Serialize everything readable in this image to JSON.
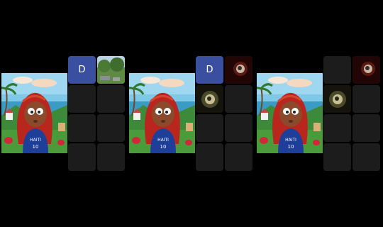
{
  "panels": [
    {
      "avatar_letter": "D",
      "slots": [
        "avatar",
        "photo-landscape",
        "empty",
        "empty",
        "empty",
        "empty",
        "empty",
        "empty"
      ]
    },
    {
      "avatar_letter": "D",
      "slots": [
        "avatar",
        "photo-dark-red",
        "photo-dark-olive",
        "empty",
        "empty",
        "empty",
        "empty",
        "empty"
      ]
    },
    {
      "avatar_letter": "",
      "slots": [
        "empty",
        "photo-dark-red",
        "photo-dark-olive",
        "empty",
        "empty",
        "empty",
        "empty",
        "empty"
      ]
    }
  ],
  "colors": {
    "avatar_bg": "#3a4fa0",
    "cell_bg": "#1c1c1c"
  },
  "art": {
    "shirt_text": "HAITI",
    "shirt_number": "10"
  }
}
